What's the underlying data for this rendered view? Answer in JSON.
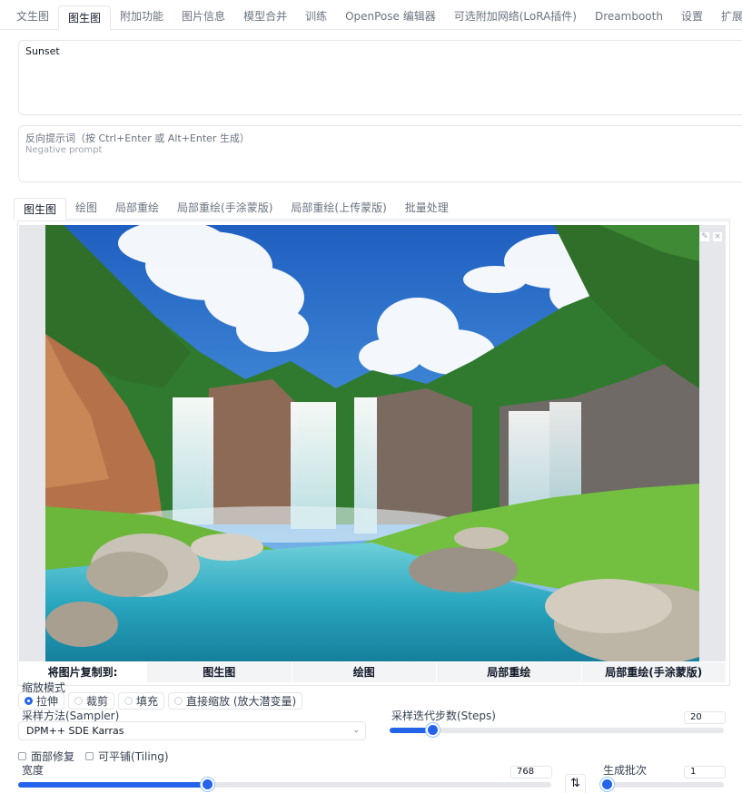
{
  "top_tabs": [
    "文生图",
    "图生图",
    "附加功能",
    "图片信息",
    "模型合并",
    "训练",
    "OpenPose 编辑器",
    "可选附加网络(LoRA插件)",
    "Dreambooth",
    "设置",
    "扩展"
  ],
  "active_top_tab": "图生图",
  "prompt": {
    "value": "Sunset"
  },
  "negative_prompt": {
    "label": "反向提示词（按 Ctrl+Enter 或 Alt+Enter 生成）",
    "placeholder": "Negative prompt"
  },
  "sub_tabs": [
    "图生图",
    "绘图",
    "局部重绘",
    "局部重绘(手涂蒙版)",
    "局部重绘(上传蒙版)",
    "批量处理"
  ],
  "active_sub_tab": "图生图",
  "image_tools": {
    "edit": "✎",
    "close": "×"
  },
  "copy_to": {
    "label": "将图片复制到:",
    "targets": [
      "图生图",
      "绘图",
      "局部重绘",
      "局部重绘(手涂蒙版)"
    ]
  },
  "resize_mode": {
    "label": "缩放模式",
    "options": [
      "拉伸",
      "裁剪",
      "填充",
      "直接缩放 (放大潜变量)"
    ],
    "selected": "拉伸"
  },
  "sampler": {
    "label": "采样方法(Sampler)",
    "value": "DPM++ SDE Karras"
  },
  "steps": {
    "label": "采样迭代步数(Steps)",
    "value": "20",
    "min": 1,
    "max": 150
  },
  "checkboxes": {
    "face_restore": "面部修复",
    "tiling": "可平铺(Tiling)"
  },
  "width": {
    "label": "宽度",
    "value": "768",
    "min": 64,
    "max": 2048
  },
  "swap": {
    "icon": "⇅"
  },
  "batch_count": {
    "label": "生成批次",
    "value": "1",
    "min": 1,
    "max": 100
  },
  "colors": {
    "accent": "#2563eb",
    "border": "#e5e7eb"
  }
}
